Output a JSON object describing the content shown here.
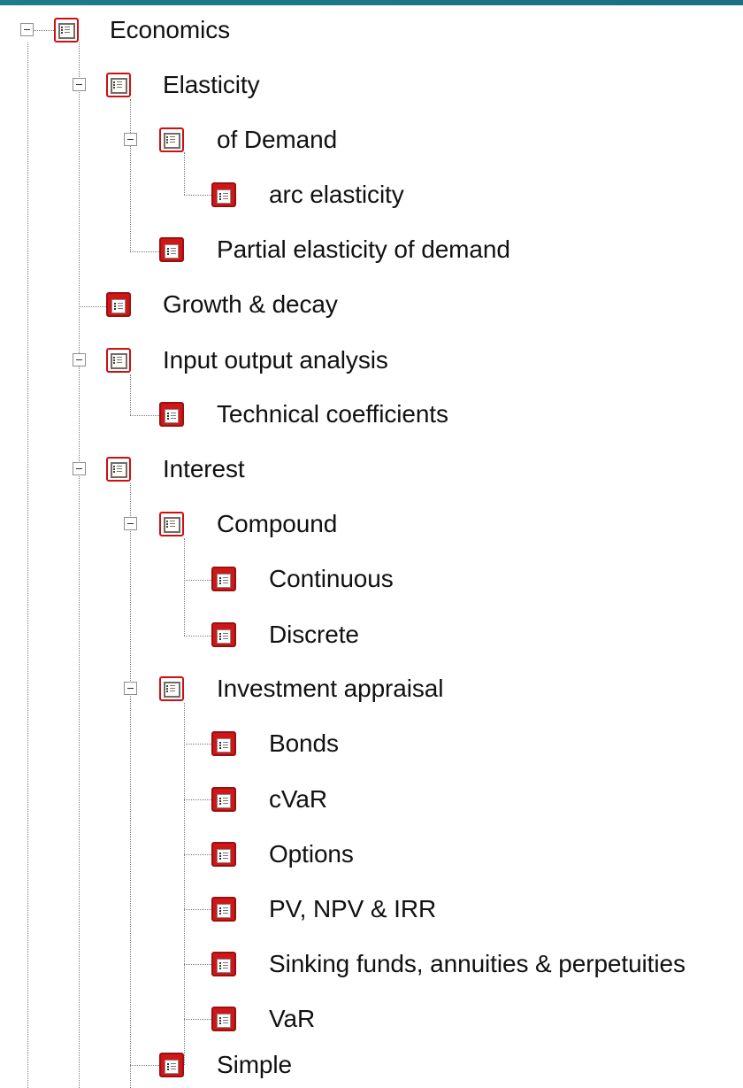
{
  "tree": {
    "nodes": [
      {
        "id": "economics",
        "label": "Economics",
        "icon": "book-icon",
        "state": "expanded"
      },
      {
        "id": "elasticity",
        "label": "Elasticity",
        "icon": "book-icon",
        "state": "expanded"
      },
      {
        "id": "of-demand",
        "label": "of Demand",
        "icon": "book-icon",
        "state": "expanded"
      },
      {
        "id": "arc-elasticity",
        "label": "arc elasticity",
        "icon": "page-icon",
        "state": "leaf"
      },
      {
        "id": "partial-elasticity-of-demand",
        "label": "Partial elasticity of demand",
        "icon": "page-icon",
        "state": "leaf"
      },
      {
        "id": "growth-decay",
        "label": "Growth & decay",
        "icon": "page-icon",
        "state": "leaf"
      },
      {
        "id": "input-output-analysis",
        "label": "Input output analysis",
        "icon": "book-icon",
        "state": "expanded"
      },
      {
        "id": "technical-coefficients",
        "label": "Technical coefficients",
        "icon": "page-icon",
        "state": "leaf"
      },
      {
        "id": "interest",
        "label": "Interest",
        "icon": "book-icon",
        "state": "expanded"
      },
      {
        "id": "compound",
        "label": "Compound",
        "icon": "book-icon",
        "state": "expanded"
      },
      {
        "id": "continuous",
        "label": "Continuous",
        "icon": "page-icon",
        "state": "leaf"
      },
      {
        "id": "discrete",
        "label": "Discrete",
        "icon": "page-icon",
        "state": "leaf"
      },
      {
        "id": "investment-appraisal",
        "label": "Investment appraisal",
        "icon": "book-icon",
        "state": "expanded"
      },
      {
        "id": "bonds",
        "label": "Bonds",
        "icon": "page-icon",
        "state": "leaf"
      },
      {
        "id": "cvar",
        "label": "cVaR",
        "icon": "page-icon",
        "state": "leaf"
      },
      {
        "id": "options",
        "label": "Options",
        "icon": "page-icon",
        "state": "leaf"
      },
      {
        "id": "pv-npv-irr",
        "label": "PV, NPV & IRR",
        "icon": "page-icon",
        "state": "leaf"
      },
      {
        "id": "sinking-funds-annuities-perpetuities",
        "label": "Sinking funds, annuities & perpetuities",
        "icon": "page-icon",
        "state": "leaf"
      },
      {
        "id": "var",
        "label": "VaR",
        "icon": "page-icon",
        "state": "leaf"
      },
      {
        "id": "simple",
        "label": "Simple",
        "icon": "page-icon",
        "state": "leaf"
      }
    ]
  },
  "colors": {
    "accent_strip": "#1d7d88",
    "icon_red": "#cf1717",
    "guide_line": "#7a7a7a"
  }
}
